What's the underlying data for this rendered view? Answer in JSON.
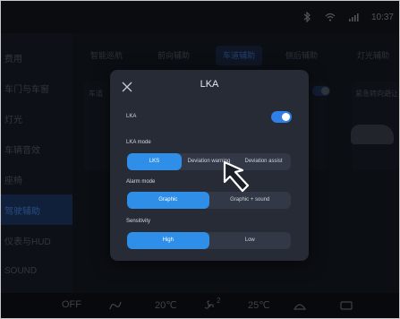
{
  "status_bar": {
    "time": "10:37"
  },
  "sidebar": {
    "items": [
      {
        "label": "费用"
      },
      {
        "label": "车门与车窗"
      },
      {
        "label": "灯光"
      },
      {
        "label": "车辆音效"
      },
      {
        "label": "座椅"
      },
      {
        "label": "驾驶辅助",
        "active": true
      },
      {
        "label": "仪表与HUD"
      },
      {
        "label": "SOUND"
      }
    ]
  },
  "tabs": [
    {
      "label": "智能巡航"
    },
    {
      "label": "前向辅助"
    },
    {
      "label": "车道辅助",
      "active": true
    },
    {
      "label": "侧后辅助"
    },
    {
      "label": "灯光辅助"
    }
  ],
  "bg_cards": {
    "left_title": "车道",
    "right_title": "紧急转向避让"
  },
  "modal": {
    "title": "LKA",
    "lka_label": "LKA",
    "lka_enabled": true,
    "lka_mode": {
      "label": "LKA mode",
      "options": [
        "LKS",
        "Deviation warning",
        "Deviation assist"
      ],
      "selected": "LKS"
    },
    "alarm_mode": {
      "label": "Alarm mode",
      "options": [
        "Graphic",
        "Graphic + sound"
      ],
      "selected": "Graphic"
    },
    "sensitivity": {
      "label": "Sensitivity",
      "options": [
        "High",
        "Low"
      ],
      "selected": "High"
    }
  },
  "bottom_bar": {
    "ac_state": "OFF",
    "left_temp": "20℃",
    "fan_level": "2",
    "right_temp": "25℃"
  },
  "colors": {
    "accent": "#2f8fe8",
    "panel": "#262b35"
  }
}
